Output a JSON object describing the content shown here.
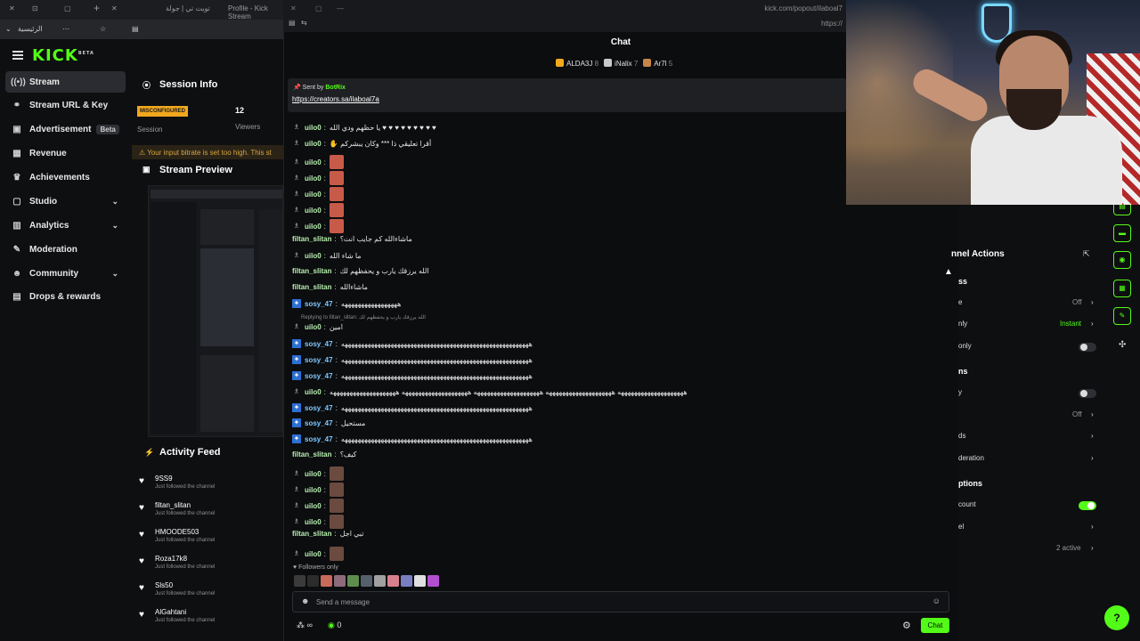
{
  "browser": {
    "tab1": "تويت تي | جولة",
    "tab2": "Profile - Kick Stream",
    "addr_prefix": "الرئيسية"
  },
  "dashboard": {
    "logo": "KICK",
    "logo_sup": "BETA",
    "nav": [
      {
        "label": "Stream",
        "icon": "broadcast-icon"
      },
      {
        "label": "Stream URL & Key",
        "icon": "link-icon"
      },
      {
        "label": "Advertisement",
        "icon": "ad-icon",
        "badge": "Beta"
      },
      {
        "label": "Revenue",
        "icon": "dollar-icon"
      },
      {
        "label": "Achievements",
        "icon": "trophy-icon"
      },
      {
        "label": "Studio",
        "icon": "studio-icon"
      },
      {
        "label": "Analytics",
        "icon": "chart-icon"
      },
      {
        "label": "Moderation",
        "icon": "wrench-icon"
      },
      {
        "label": "Community",
        "icon": "people-icon"
      },
      {
        "label": "Drops & rewards",
        "icon": "gift-icon"
      }
    ],
    "session_info_title": "Session Info",
    "session_status": "MISCONFIGURED",
    "session_label": "Session",
    "viewers_value": "12",
    "viewers_label": "Viewers",
    "warning": "Your input bitrate is set too high. This st",
    "preview_title": "Stream Preview",
    "activity_title": "Activity Feed",
    "activity": [
      {
        "name": "9SS9",
        "sub": "Just followed the channel"
      },
      {
        "name": "filtan_slitan",
        "sub": "Just followed the channel"
      },
      {
        "name": "HMOODE503",
        "sub": "Just followed the channel"
      },
      {
        "name": "Roza17k8",
        "sub": "Just followed the channel"
      },
      {
        "name": "Sls50",
        "sub": "Just followed the channel"
      },
      {
        "name": "AlGahtani",
        "sub": "Just followed the channel"
      }
    ]
  },
  "chat": {
    "url": "kick.com/popout/ilaboal7",
    "url2": "https://",
    "title": "Chat",
    "gifters": [
      {
        "name": "ALDA3J",
        "count": "8",
        "color": "#f1a81d"
      },
      {
        "name": "iNalix",
        "count": "7",
        "color": "#c9c9c9"
      },
      {
        "name": "Ar7l",
        "count": "5",
        "color": "#c8864a"
      }
    ],
    "pinned_by_label": "Sent by",
    "pinned_by_user": "BotRix",
    "pinned_link": "https://creators.sa/ilaboal7a",
    "messages": [
      {
        "user": "uilo0",
        "color": "#b7f0b0",
        "text": "يا حظهم ودي الله ♥ ♥ ♥ ♥ ♥ ♥ ♥ ♥ ♥",
        "badge": "fig"
      },
      {
        "user": "uilo0",
        "color": "#b7f0b0",
        "text": "✋ أقرا تعليقي ذا *** وكان يبشركم",
        "badge": "fig"
      },
      {
        "user": "uilo0",
        "color": "#b7f0b0",
        "text": "",
        "badge": "fig",
        "emote": true
      },
      {
        "user": "uilo0",
        "color": "#b7f0b0",
        "text": "",
        "badge": "fig",
        "emote": true
      },
      {
        "user": "uilo0",
        "color": "#b7f0b0",
        "text": "",
        "badge": "fig",
        "emote": true
      },
      {
        "user": "uilo0",
        "color": "#b7f0b0",
        "text": "",
        "badge": "fig",
        "emote": true
      },
      {
        "user": "uilo0",
        "color": "#b7f0b0",
        "text": "",
        "badge": "fig",
        "emote": true
      },
      {
        "user": "filtan_slitan",
        "color": "#b7f0b0",
        "text": "ماشاءالله كم جايب انت؟",
        "badge": ""
      },
      {
        "user": "uilo0",
        "color": "#b7f0b0",
        "text": "ما شاء الله",
        "badge": "fig"
      },
      {
        "user": "filtan_slitan",
        "color": "#b7f0b0",
        "text": "الله يرزقك يارب و يحفظهم لك",
        "badge": ""
      },
      {
        "user": "filtan_slitan",
        "color": "#b7f0b0",
        "text": "ماشاءالله",
        "badge": ""
      },
      {
        "user": "sosy_47",
        "color": "#7ec8ff",
        "text": "هههههههههههههههههه",
        "badge": "sub"
      },
      {
        "user": "uilo0",
        "color": "#b7f0b0",
        "text": "امين",
        "badge": "fig"
      },
      {
        "user": "sosy_47",
        "color": "#7ec8ff",
        "text": "هههههههههههههههههههههههههههههههههههههههههههههههههههههههههه",
        "badge": "sub"
      },
      {
        "user": "sosy_47",
        "color": "#7ec8ff",
        "text": "هههههههههههههههههههههههههههههههههههههههههههههههههههههههههه",
        "badge": "sub"
      },
      {
        "user": "sosy_47",
        "color": "#7ec8ff",
        "text": "هههههههههههههههههههههههههههههههههههههههههههههههههههههههههه",
        "badge": "sub"
      },
      {
        "user": "uilo0",
        "color": "#b7f0b0",
        "text": "ههههههههههههههههههههه ههههههههههههههههههههه ههههههههههههههههههههه ههههههههههههههههههههه ههههههههههههههههههههه",
        "badge": "fig"
      },
      {
        "user": "sosy_47",
        "color": "#7ec8ff",
        "text": "هههههههههههههههههههههههههههههههههههههههههههههههههههههههههه",
        "badge": "sub"
      },
      {
        "user": "sosy_47",
        "color": "#7ec8ff",
        "text": "مستحيل",
        "badge": "sub"
      },
      {
        "user": "sosy_47",
        "color": "#7ec8ff",
        "text": "هههههههههههههههههههههههههههههههههههههههههههههههههههههههههه",
        "badge": "sub"
      },
      {
        "user": "filtan_slitan",
        "color": "#b7f0b0",
        "text": "كيف؟",
        "badge": ""
      },
      {
        "user": "uilo0",
        "color": "#b7f0b0",
        "text": "",
        "badge": "fig",
        "sticker": true
      },
      {
        "user": "uilo0",
        "color": "#b7f0b0",
        "text": "",
        "badge": "fig",
        "sticker": true
      },
      {
        "user": "uilo0",
        "color": "#b7f0b0",
        "text": "",
        "badge": "fig",
        "sticker": true
      },
      {
        "user": "uilo0",
        "color": "#b7f0b0",
        "text": "",
        "badge": "fig",
        "sticker": true
      },
      {
        "user": "filtan_slitan",
        "color": "#b7f0b0",
        "text": "تبي اجل",
        "badge": ""
      },
      {
        "user": "uilo0",
        "color": "#b7f0b0",
        "text": "",
        "badge": "fig",
        "sticker": true
      }
    ],
    "reply_note": "Replying to filtan_slitan: الله يرزقك يارب و يحفظهم لك",
    "followers_only": "Followers only",
    "input_placeholder": "Send a message",
    "infinity_label": "∞",
    "points_value": "0",
    "send_label": "Chat"
  },
  "right_panel": {
    "title": "nnel Actions",
    "rows": [
      {
        "label": "ss",
        "value": "",
        "bold": true
      },
      {
        "label": "e",
        "value": "Off"
      },
      {
        "label": "nly",
        "value": "Instant",
        "green": true
      },
      {
        "label": "only",
        "toggle": "off"
      },
      {
        "label": "ns",
        "value": "",
        "bold": true
      },
      {
        "label": "y",
        "toggle": "off"
      },
      {
        "label": "",
        "value": "Off"
      },
      {
        "label": "ds",
        "value": ""
      },
      {
        "label": "deration",
        "value": ""
      },
      {
        "label": "ptions",
        "value": "",
        "bold": true
      },
      {
        "label": "count",
        "toggle": "on"
      },
      {
        "label": "el",
        "value": ""
      },
      {
        "label": "",
        "value": "2 active"
      }
    ]
  }
}
